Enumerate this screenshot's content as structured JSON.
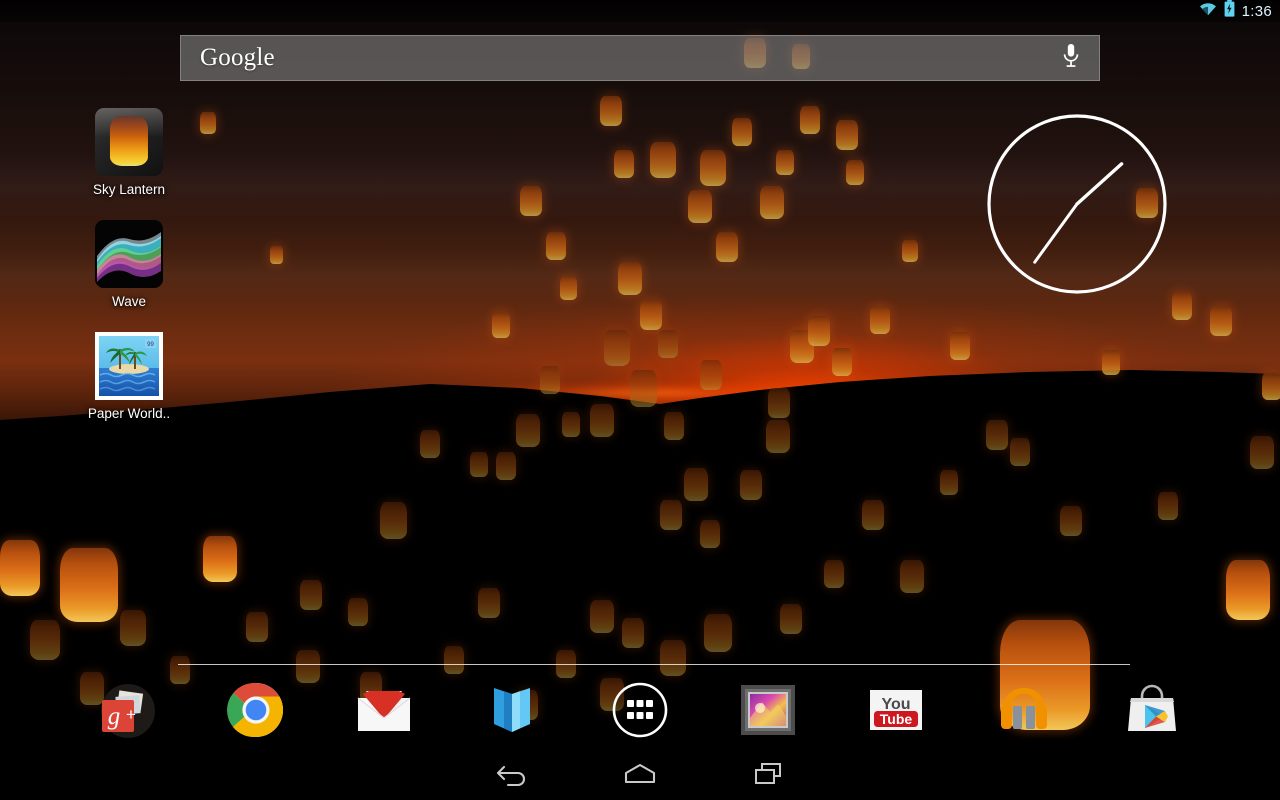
{
  "status_bar": {
    "time": "1:36",
    "icons": [
      {
        "name": "wifi-icon",
        "label": "Wi-Fi connected"
      },
      {
        "name": "battery-charging-icon",
        "label": "Battery charging"
      }
    ],
    "time_color": "#dff3fb"
  },
  "search": {
    "brand_label": "Google",
    "placeholder": "Google",
    "voice_icon": "microphone-icon",
    "background_color": "#828282"
  },
  "clock_widget": {
    "type": "analog-clock",
    "time": "1:36",
    "hour_angle_deg": 48,
    "minute_angle_deg": 216,
    "stroke_color": "#ffffff"
  },
  "shortcuts": [
    {
      "id": "sky-lantern",
      "label": "Sky Lantern",
      "icon": "sky-lantern-icon"
    },
    {
      "id": "wave",
      "label": "Wave",
      "icon": "wave-icon"
    },
    {
      "id": "paper-world",
      "label": "Paper World..",
      "icon": "paper-world-stamp-icon"
    }
  ],
  "dock": {
    "items": [
      {
        "id": "google-plus",
        "label": "Google+",
        "icon": "google-plus-icon",
        "color": "#d93025"
      },
      {
        "id": "chrome",
        "label": "Chrome",
        "icon": "chrome-icon",
        "color": "#4285f4"
      },
      {
        "id": "gmail",
        "label": "Gmail",
        "icon": "gmail-icon",
        "color": "#d93025"
      },
      {
        "id": "play-books",
        "label": "Play Books",
        "icon": "play-books-icon",
        "color": "#2f9fe0"
      },
      {
        "id": "all-apps",
        "label": "Apps",
        "icon": "all-apps-grid-icon",
        "color": "#ffffff"
      },
      {
        "id": "gallery",
        "label": "Gallery",
        "icon": "gallery-icon",
        "color": "#b0479a"
      },
      {
        "id": "youtube",
        "label": "YouTube",
        "icon": "youtube-icon",
        "color": "#cc181e"
      },
      {
        "id": "play-music",
        "label": "Play Music",
        "icon": "play-music-headphones-icon",
        "color": "#f29100"
      },
      {
        "id": "play-store",
        "label": "Play Store",
        "icon": "play-store-bag-icon",
        "color": "#ffffff"
      }
    ],
    "youtube_text_top": "You",
    "youtube_text_bottom": "Tube",
    "gplus_text": "g+"
  },
  "nav_bar": {
    "buttons": [
      {
        "id": "back",
        "label": "Back",
        "icon": "back-arrow-icon"
      },
      {
        "id": "home",
        "label": "Home",
        "icon": "home-icon"
      },
      {
        "id": "recents",
        "label": "Recent apps",
        "icon": "recent-apps-icon"
      }
    ],
    "background_color": "#000000"
  },
  "wallpaper": {
    "name": "Sky Lantern live wallpaper",
    "description": "Orange sky lanterns floating over a dark sunset horizon with black hills",
    "sunset_glow_color": "#ff4600",
    "lantern_color": "#e8761a"
  }
}
